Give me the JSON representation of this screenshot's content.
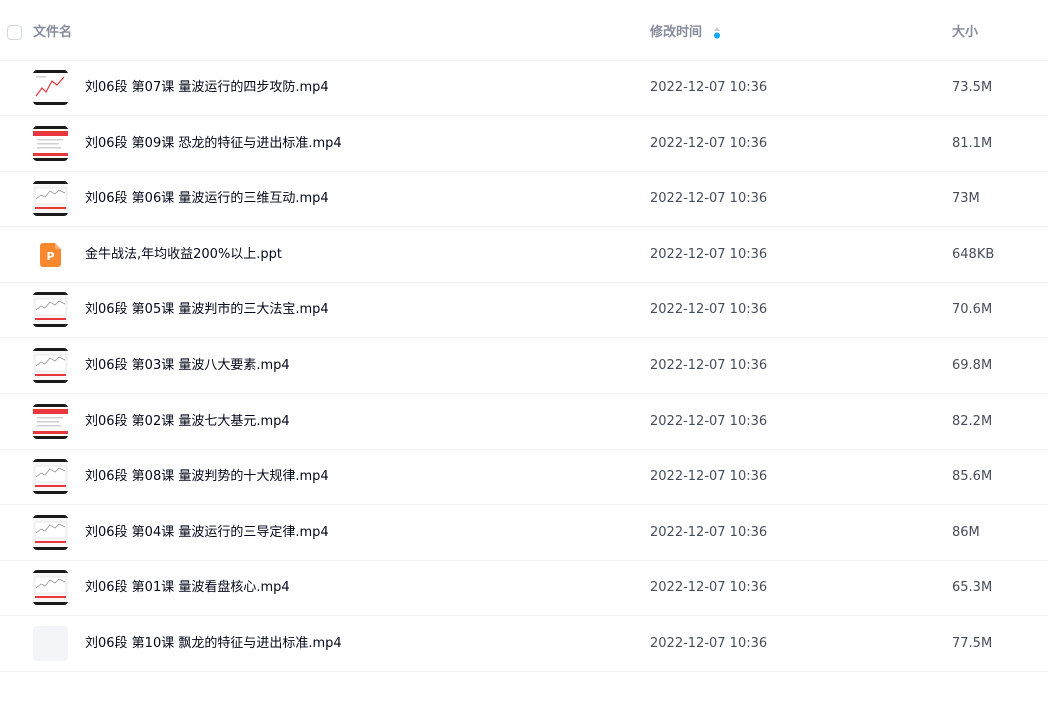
{
  "header": {
    "name_label": "文件名",
    "time_label": "修改时间",
    "size_label": "大小"
  },
  "colors": {
    "header_text": "#878c9c",
    "sort_icon": "#06a7ff",
    "thumb_red": "#e8383d",
    "ppt_orange": "#f7882e"
  },
  "files": [
    {
      "name": "刘06段 第07课 量波运行的四步攻防.mp4",
      "time": "2022-12-07 10:36",
      "size": "73.5M",
      "icon": "video-thumbnail-icon"
    },
    {
      "name": "刘06段 第09课 恐龙的特征与进出标准.mp4",
      "time": "2022-12-07 10:36",
      "size": "81.1M",
      "icon": "video-thumbnail-icon"
    },
    {
      "name": "刘06段 第06课 量波运行的三维互动.mp4",
      "time": "2022-12-07 10:36",
      "size": "73M",
      "icon": "video-thumbnail-icon"
    },
    {
      "name": "金牛战法,年均收益200%以上.ppt",
      "time": "2022-12-07 10:36",
      "size": "648KB",
      "icon": "ppt-file-icon"
    },
    {
      "name": "刘06段 第05课 量波判市的三大法宝.mp4",
      "time": "2022-12-07 10:36",
      "size": "70.6M",
      "icon": "video-thumbnail-icon"
    },
    {
      "name": "刘06段 第03课 量波八大要素.mp4",
      "time": "2022-12-07 10:36",
      "size": "69.8M",
      "icon": "video-thumbnail-icon"
    },
    {
      "name": "刘06段 第02课 量波七大基元.mp4",
      "time": "2022-12-07 10:36",
      "size": "82.2M",
      "icon": "video-thumbnail-icon"
    },
    {
      "name": "刘06段 第08课 量波判势的十大规律.mp4",
      "time": "2022-12-07 10:36",
      "size": "85.6M",
      "icon": "video-thumbnail-icon"
    },
    {
      "name": "刘06段 第04课 量波运行的三导定律.mp4",
      "time": "2022-12-07 10:36",
      "size": "86M",
      "icon": "video-thumbnail-icon"
    },
    {
      "name": "刘06段 第01课 量波看盘核心.mp4",
      "time": "2022-12-07 10:36",
      "size": "65.3M",
      "icon": "video-thumbnail-icon"
    },
    {
      "name": "刘06段 第10课 飘龙的特征与进出标准.mp4",
      "time": "2022-12-07 10:36",
      "size": "77.5M",
      "icon": "blank-thumbnail-icon"
    }
  ]
}
